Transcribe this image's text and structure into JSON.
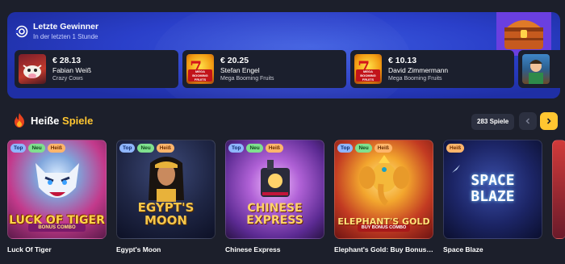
{
  "winners": {
    "title": "Letzte Gewinner",
    "subtitle": "In der letzten 1 Stunde",
    "items": [
      {
        "amount": "€ 28.13",
        "name": "Fabian Weiß",
        "game": "Crazy Cows"
      },
      {
        "amount": "€ 20.25",
        "name": "Stefan Engel",
        "game": "Mega Booming Fruits",
        "thumb_label": "MEGA BOOMING FRUITS"
      },
      {
        "amount": "€ 10.13",
        "name": "David Zimmermann",
        "game": "Mega Booming Fruits",
        "thumb_label": "MEGA BOOMING FRUITS"
      }
    ]
  },
  "hot_games": {
    "title_main": "Heiße",
    "title_accent": "Spiele",
    "count_label": "283 Spiele",
    "games": [
      {
        "name": "Luck Of Tiger",
        "badges": [
          "Top",
          "Neu",
          "Heiß"
        ],
        "logo": "LUCK OF TIGER",
        "logo_sub": "BONUS COMBO"
      },
      {
        "name": "Egypt's Moon",
        "badges": [
          "Top",
          "Neu",
          "Heiß"
        ],
        "logo_line1": "EGYPT'S",
        "logo_line2": "MOON"
      },
      {
        "name": "Chinese Express",
        "badges": [
          "Top",
          "Neu",
          "Heiß"
        ],
        "logo_line1": "CHINESE",
        "logo_line2": "EXPRESS"
      },
      {
        "name": "Elephant's Gold: Buy Bonus Combo",
        "badges": [
          "Top",
          "Neu",
          "Heiß"
        ],
        "logo": "ELEPHANT'S GOLD",
        "logo_sub": "BUY BONUS COMBO"
      },
      {
        "name": "Space Blaze",
        "badges": [
          "Heiß"
        ],
        "logo_line1": "SPACE",
        "logo_line2": "BLAZE"
      }
    ]
  },
  "colors": {
    "accent": "#ffc631",
    "banner": "#2a3fc9",
    "background": "#1c1f2b"
  },
  "icons": {
    "live": "live-signal-icon",
    "fire": "fire-icon",
    "prev": "chevron-left-icon",
    "next": "chevron-right-icon",
    "chest": "treasure-chest-icon"
  }
}
